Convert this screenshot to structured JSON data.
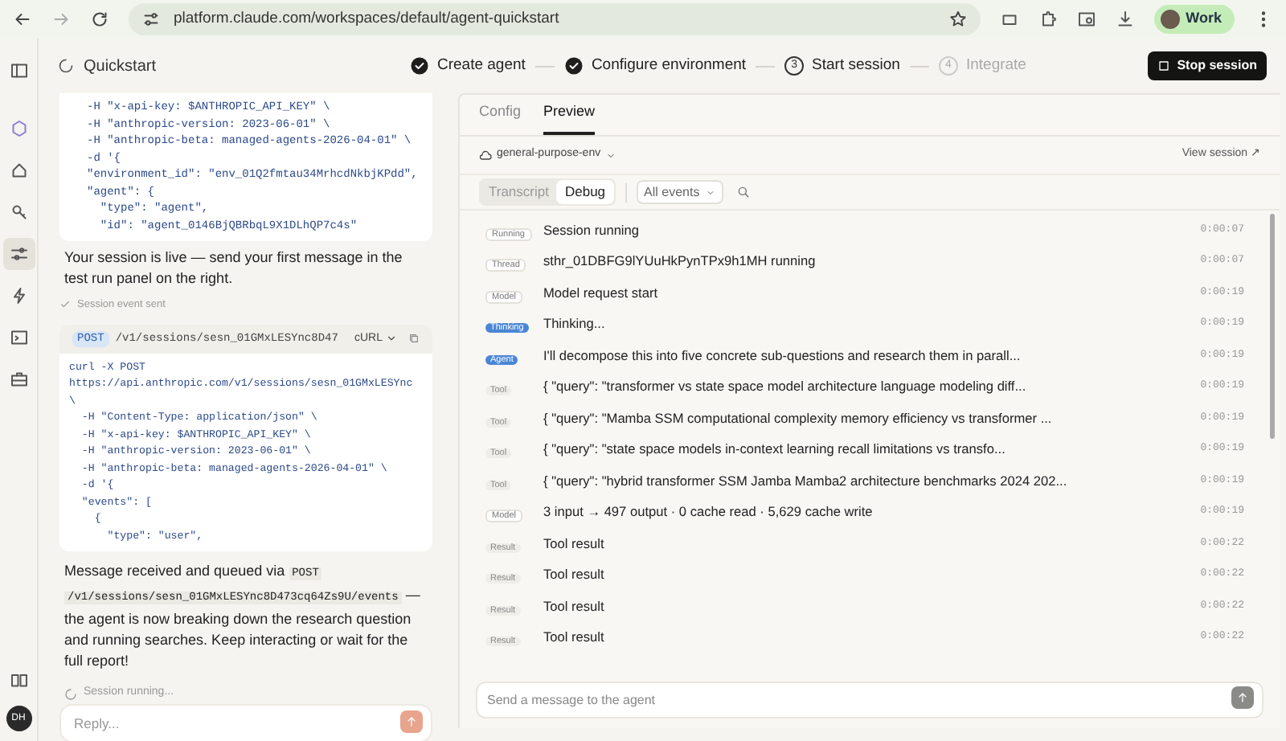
{
  "browser": {
    "url": "platform.claude.com/workspaces/default/agent-quickstart",
    "profile": "Work"
  },
  "sidebar": {
    "items": [
      {
        "selected": false
      },
      {
        "selected": false
      },
      {
        "selected": false
      },
      {
        "selected": false
      },
      {
        "selected": true
      },
      {
        "selected": false
      },
      {
        "selected": false
      },
      {
        "selected": false
      }
    ],
    "avatar": "DH"
  },
  "header": {
    "title": "Quickstart",
    "steps": [
      {
        "label": "Create agent",
        "done": true
      },
      {
        "label": "Configure environment",
        "done": true
      },
      {
        "number": "3",
        "label": "Start session",
        "done": false,
        "active": true
      },
      {
        "number": "4",
        "label": "Integrate",
        "done": false,
        "active": false
      }
    ],
    "stop_button": "Stop session"
  },
  "chat": {
    "code_block_1": {
      "lines": [
        "-H \"x-api-key: $ANTHROPIC_API_KEY\" \\",
        "-H \"anthropic-version: 2023-06-01\" \\",
        "-H \"anthropic-beta: managed-agents-2026-04-01\" \\",
        "-d '{",
        "\"environment_id\": \"env_01Q2fmtau34MrhcdNkbjKPdd\",",
        "\"agent\": {",
        "  \"type\": \"agent\",",
        "  \"id\": \"agent_0146BjQBRbqL9X1DLhQP7c4s\""
      ]
    },
    "message_1": "Your session is live — send your first message in the test run panel on the right.",
    "event_note": "Session event sent",
    "code_block_2": {
      "method": "POST",
      "path": "/v1/sessions/sesn_01GMxLESYnc8D47",
      "language": "cURL",
      "lines": [
        "curl -X POST",
        "https://api.anthropic.com/v1/sessions/sesn_01GMxLESYnc",
        "\\",
        "  -H \"Content-Type: application/json\" \\",
        "  -H \"x-api-key: $ANTHROPIC_API_KEY\" \\",
        "  -H \"anthropic-version: 2023-06-01\" \\",
        "  -H \"anthropic-beta: managed-agents-2026-04-01\" \\",
        "  -d '{",
        "  \"events\": [",
        "    {",
        "      \"type\": \"user\","
      ]
    },
    "message_2": [
      {
        "kind": "text",
        "text": "Message received and queued via"
      },
      {
        "kind": "code",
        "text": "POST"
      },
      {
        "kind": "code",
        "text": "/v1/sessions/sesn_01GMxLESYnc8D473cq64Zs9U/events"
      },
      {
        "kind": "text",
        "text": "— the agent is now breaking down the research question and running searches. Keep interacting or wait for the full report!"
      }
    ],
    "status": "Session running...",
    "reply": {
      "placeholder": "Reply..."
    }
  },
  "preview": {
    "tabs": [
      {
        "label": "Config",
        "selected": false
      },
      {
        "label": "Preview",
        "selected": true
      }
    ],
    "environment": "general-purpose-env",
    "view_session": "View session ↗",
    "view_tabs": [
      {
        "label": "Transcript",
        "selected": false
      },
      {
        "label": "Debug",
        "selected": true
      }
    ],
    "filter": "All events",
    "events": [
      {
        "tag": "Running",
        "kind": "outline",
        "text": "Session running",
        "time": "0:00:07"
      },
      {
        "tag": "Thread",
        "kind": "outline",
        "text": "sthr_01DBFG9lYUuHkPynTPx9h1MH running",
        "time": "0:00:07"
      },
      {
        "tag": "Model",
        "kind": "outline",
        "text": "Model request start",
        "time": "0:00:19"
      },
      {
        "tag": "Thinking",
        "kind": "accent",
        "text": "Thinking...",
        "time": "0:00:19"
      },
      {
        "tag": "Agent",
        "kind": "accent",
        "text": "I'll decompose this into five concrete sub-questions and research them in parall...",
        "time": "0:00:19"
      },
      {
        "tag": "Tool",
        "kind": "muted",
        "text": "{ \"query\": \"transformer vs state space model architecture language modeling diff...",
        "time": "0:00:19"
      },
      {
        "tag": "Tool",
        "kind": "muted",
        "text": "{ \"query\": \"Mamba SSM computational complexity memory efficiency vs transformer ...",
        "time": "0:00:19"
      },
      {
        "tag": "Tool",
        "kind": "muted",
        "text": "{ \"query\": \"state space models in-context learning recall limitations vs transfo...",
        "time": "0:00:19"
      },
      {
        "tag": "Tool",
        "kind": "muted",
        "text": "{ \"query\": \"hybrid transformer SSM Jamba Mamba2 architecture benchmarks 2024 202...",
        "time": "0:00:19"
      },
      {
        "tag": "Model",
        "kind": "outline",
        "text": "3 input → 497 output · 0 cache read · 5,629 cache write",
        "time": "0:00:19"
      },
      {
        "tag": "Result",
        "kind": "muted",
        "text": "Tool result",
        "time": "0:00:22"
      },
      {
        "tag": "Result",
        "kind": "muted",
        "text": "Tool result",
        "time": "0:00:22"
      },
      {
        "tag": "Result",
        "kind": "muted",
        "text": "Tool result",
        "time": "0:00:22"
      },
      {
        "tag": "Result",
        "kind": "muted",
        "text": "Tool result",
        "time": "0:00:22"
      }
    ],
    "message": {
      "placeholder": "Send a message to the agent"
    }
  }
}
